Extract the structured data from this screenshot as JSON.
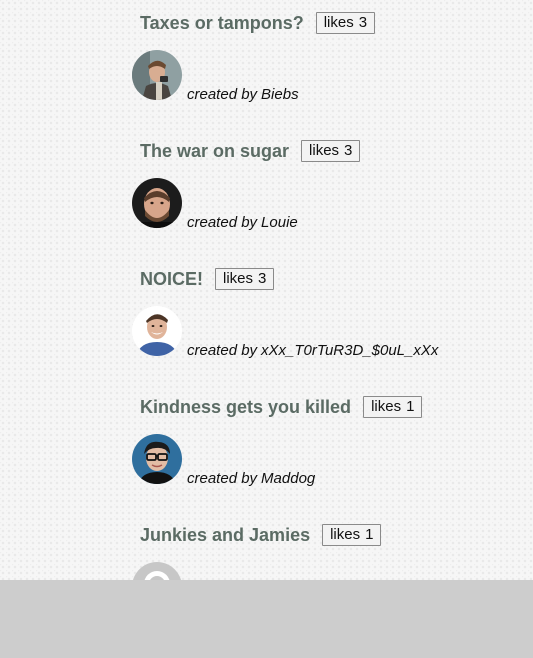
{
  "posts": [
    {
      "title": "Taxes or tampons?",
      "likes_label": "likes",
      "likes_count": "3",
      "created_by_label": "created by",
      "author": "Biebs"
    },
    {
      "title": "The war on sugar",
      "likes_label": "likes",
      "likes_count": "3",
      "created_by_label": "created by",
      "author": "Louie"
    },
    {
      "title": "NOICE!",
      "likes_label": "likes",
      "likes_count": "3",
      "created_by_label": "created by",
      "author": "xXx_T0rTuR3D_$0uL_xXx"
    },
    {
      "title": "Kindness gets you killed",
      "likes_label": "likes",
      "likes_count": "1",
      "created_by_label": "created by",
      "author": "Maddog"
    },
    {
      "title": "Junkies and Jamies",
      "likes_label": "likes",
      "likes_count": "1"
    }
  ],
  "colors": {
    "title": "#5b6b64",
    "bottom_bar": "#cdcdcd"
  }
}
